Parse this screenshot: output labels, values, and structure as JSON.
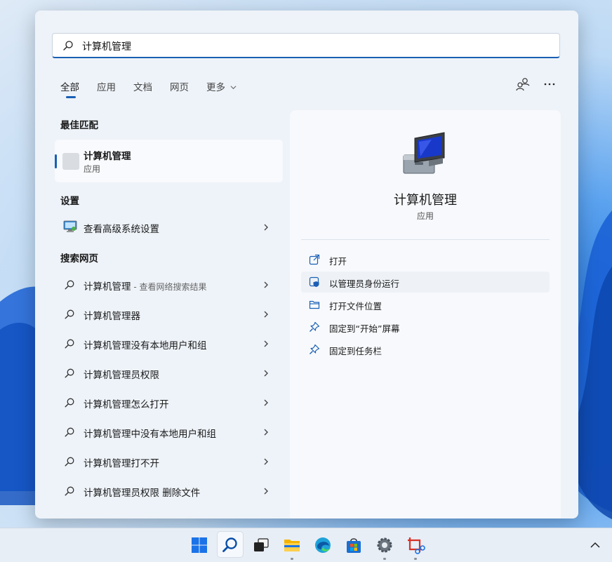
{
  "search": {
    "value": "计算机管理",
    "placeholder": ""
  },
  "tabs": [
    {
      "label": "全部",
      "active": true
    },
    {
      "label": "应用"
    },
    {
      "label": "文档"
    },
    {
      "label": "网页"
    },
    {
      "label": "更多"
    }
  ],
  "top_icons": [
    "account-switch-icon",
    "more-options-icon"
  ],
  "best_match": {
    "heading": "最佳匹配",
    "title": "计算机管理",
    "subtitle": "应用"
  },
  "settings": {
    "heading": "设置",
    "items": [
      {
        "label": "查看高级系统设置",
        "icon": "system-settings-icon"
      }
    ]
  },
  "web": {
    "heading": "搜索网页",
    "items": [
      {
        "label": "计算机管理",
        "suffix": " - 查看网络搜索结果"
      },
      {
        "label": "计算机管理器",
        "suffix": ""
      },
      {
        "label": "计算机管理没有本地用户和组",
        "suffix": ""
      },
      {
        "label": "计算机管理员权限",
        "suffix": ""
      },
      {
        "label": "计算机管理怎么打开",
        "suffix": ""
      },
      {
        "label": "计算机管理中没有本地用户和组",
        "suffix": ""
      },
      {
        "label": "计算机管理打不开",
        "suffix": ""
      },
      {
        "label": "计算机管理员权限 删除文件",
        "suffix": ""
      }
    ]
  },
  "detail": {
    "title": "计算机管理",
    "subtitle": "应用",
    "actions": [
      {
        "label": "打开",
        "icon": "open-icon"
      },
      {
        "label": "以管理员身份运行",
        "icon": "run-as-admin-icon"
      },
      {
        "label": "打开文件位置",
        "icon": "folder-icon"
      },
      {
        "label": "固定到“开始”屏幕",
        "icon": "pin-icon"
      },
      {
        "label": "固定到任务栏",
        "icon": "pin-icon"
      }
    ]
  },
  "taskbar": {
    "items": [
      "start-icon",
      "search-icon",
      "task-view-icon",
      "file-explorer-icon",
      "edge-icon",
      "store-icon",
      "settings-icon",
      "snipping-tool-icon"
    ],
    "tray": [
      "chevron-up-icon"
    ]
  },
  "colors": {
    "accent": "#1a5fb4",
    "panel": "#eef3f9",
    "detail": "#f7f9fc"
  }
}
